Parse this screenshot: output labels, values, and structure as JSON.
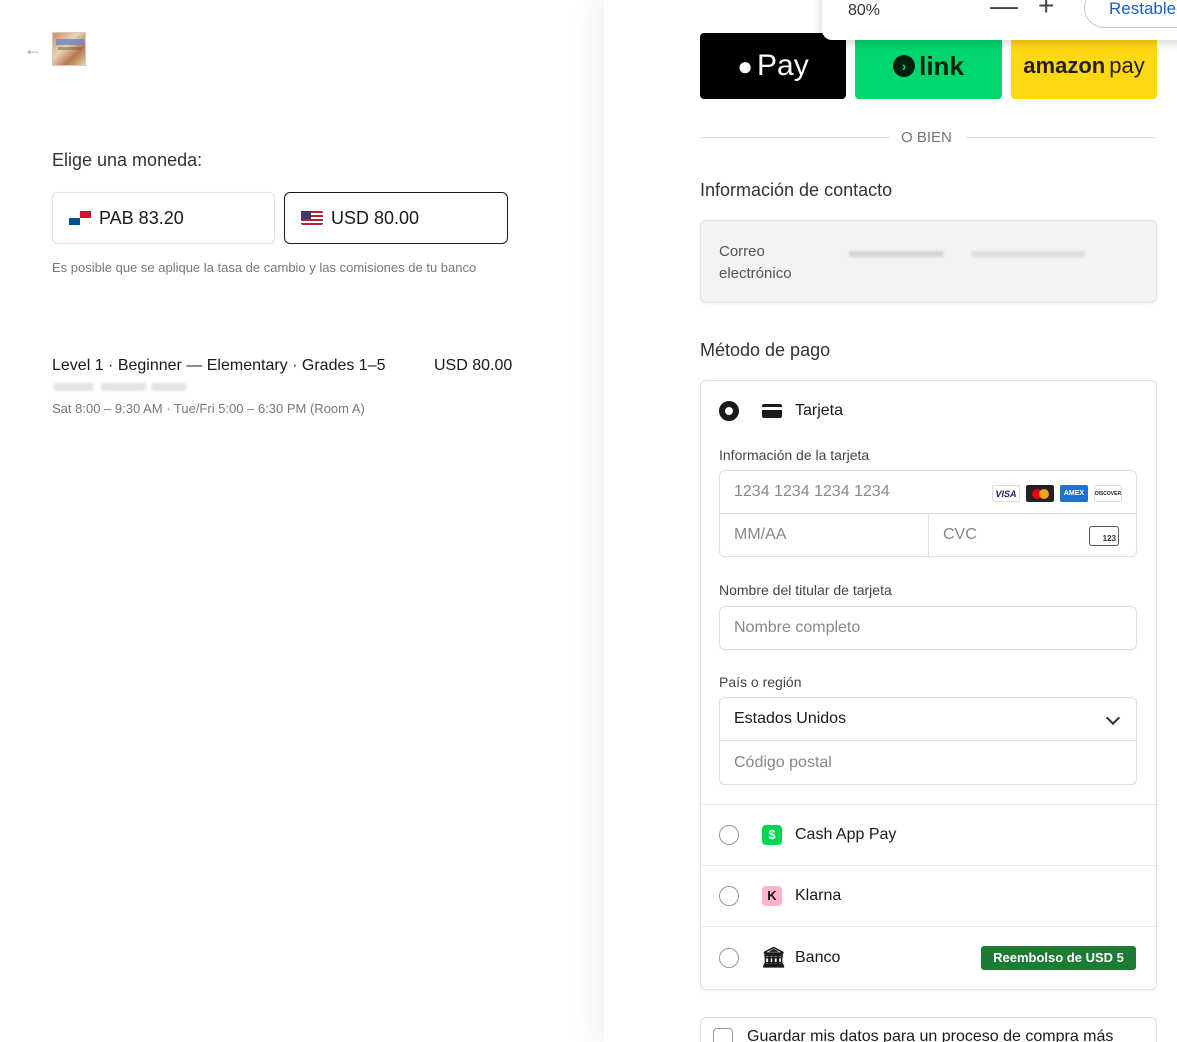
{
  "summary": {
    "currency_title": "Elige una moneda:",
    "currency_options": [
      {
        "code_amount": "PAB 83.20",
        "flag": "panama-flag-icon",
        "selected": false
      },
      {
        "code_amount": "USD 80.00",
        "flag": "us-flag-icon",
        "selected": true
      }
    ],
    "disclaimer": "Es posible que se aplique la tasa de cambio y las comisiones de tu banco",
    "item": {
      "name": "Level 1 · Beginner — Elementary · Grades 1–5",
      "price": "USD 80.00",
      "schedule": "Sat 8:00 – 9:30 AM · Tue/Fri 5:00 – 6:30 PM (Room A)"
    }
  },
  "zoom": {
    "value": "80%",
    "minus": "—",
    "plus": "+",
    "reset_label": "Restablecer"
  },
  "wallets": {
    "apple_pay": "Pay",
    "link": "link",
    "amazon_pay_brand": "amazon",
    "amazon_pay_suffix": "pay"
  },
  "divider_text": "O BIEN",
  "contact": {
    "title": "Información de contacto",
    "email_label": "Correo electrónico"
  },
  "payment": {
    "title": "Método de pago",
    "methods": [
      {
        "label": "Tarjeta",
        "selected": true
      },
      {
        "label": "Cash App Pay",
        "selected": false
      },
      {
        "label": "Klarna",
        "selected": false
      },
      {
        "label": "Banco",
        "selected": false,
        "badge": "Reembolso de USD 5"
      }
    ],
    "card_info_label": "Información de la tarjeta",
    "card_number_placeholder": "1234 1234 1234 1234",
    "expiry_placeholder": "MM/AA",
    "cvc_placeholder": "CVC",
    "cvc_icon_text": "123",
    "card_brands": [
      "VISA",
      "AMEX",
      "DISCOVER"
    ],
    "holder_label": "Nombre del titular de tarjeta",
    "holder_placeholder": "Nombre completo",
    "country_label": "País o región",
    "country_value": "Estados Unidos",
    "postal_placeholder": "Código postal",
    "cash_icon_glyph": "$",
    "klarna_icon_glyph": "K",
    "bank_icon_glyph": "🏛"
  },
  "save_info": {
    "label": "Guardar mis datos para un proceso de compra más"
  },
  "colors": {
    "apple_pay_bg": "#000000",
    "link_bg": "#00d66f",
    "amazon_bg": "#ffd814",
    "badge_green": "#1e7b34",
    "zoom_reset_text": "#1a5fc1"
  }
}
